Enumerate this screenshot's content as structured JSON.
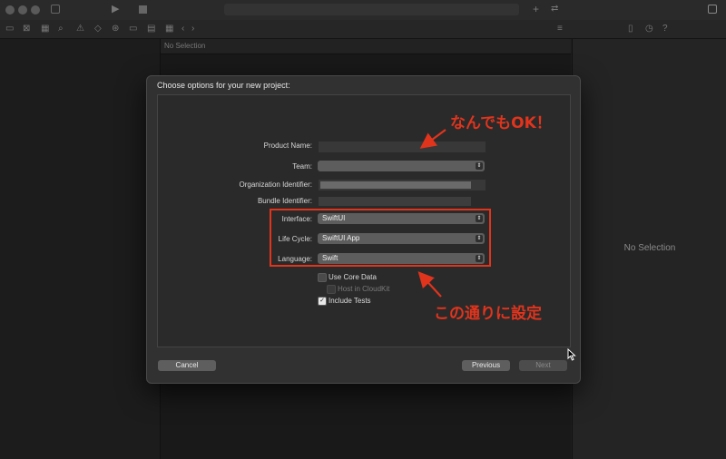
{
  "inspector": {
    "no_selection": "No Selection"
  },
  "editor": {
    "jumpbar_text": "No Selection"
  },
  "dialog": {
    "title": "Choose options for your new project:",
    "fields": {
      "product_name_label": "Product Name:",
      "team_label": "Team:",
      "org_id_label": "Organization Identifier:",
      "bundle_id_label": "Bundle Identifier:",
      "interface_label": "Interface:",
      "interface_value": "SwiftUI",
      "lifecycle_label": "Life Cycle:",
      "lifecycle_value": "SwiftUI App",
      "language_label": "Language:",
      "language_value": "Swift"
    },
    "checkboxes": {
      "use_core_data": "Use Core Data",
      "host_in_cloudkit": "Host in CloudKit",
      "include_tests": "Include Tests"
    },
    "buttons": {
      "cancel": "Cancel",
      "previous": "Previous",
      "next": "Next"
    }
  },
  "annotations": {
    "top": "なんでもOK！",
    "bottom": "この通りに設定"
  },
  "colors": {
    "annotation_red": "#e0341d"
  }
}
